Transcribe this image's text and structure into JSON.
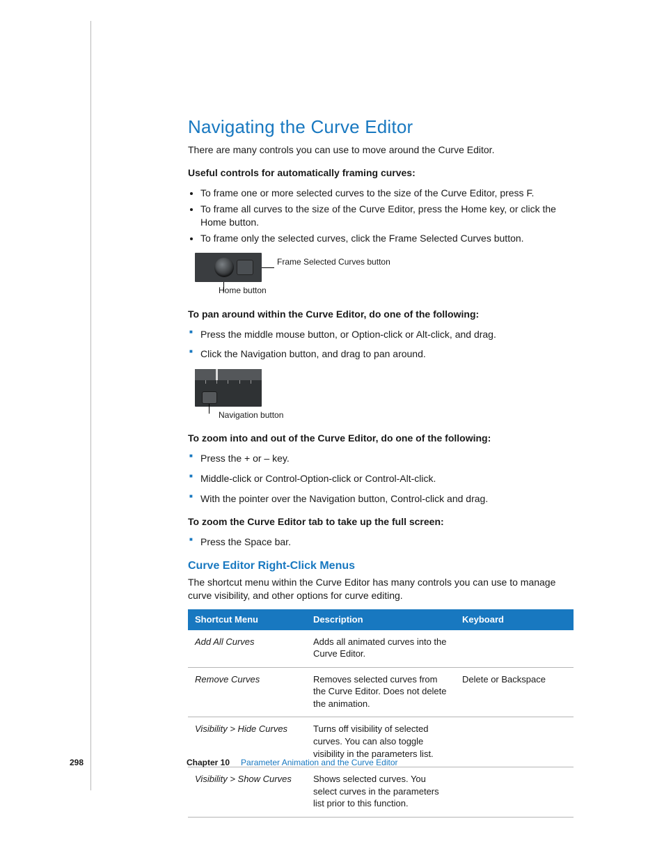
{
  "title": "Navigating the Curve Editor",
  "intro": "There are many controls you can use to move around the Curve Editor.",
  "useful_lead": "Useful controls for automatically framing curves:",
  "useful_items": [
    "To frame one or more selected curves to the size of the Curve Editor, press F.",
    "To frame all curves to the size of the Curve Editor, press the Home key, or click the Home button.",
    "To frame only the selected curves, click the Frame Selected Curves button."
  ],
  "fig1": {
    "caption_right": "Frame Selected Curves button",
    "caption_below": "Home button"
  },
  "pan_lead": "To pan around within the Curve Editor, do one of the following:",
  "pan_items": [
    "Press the middle mouse button, or Option-click or Alt-click, and drag.",
    "Click the Navigation button, and drag to pan around."
  ],
  "fig2": {
    "caption_below": "Navigation button"
  },
  "zoom_lead": "To zoom into and out of the Curve Editor, do one of the following:",
  "zoom_items": [
    "Press the + or – key.",
    "Middle-click or Control-Option-click or Control-Alt-click.",
    "With the pointer over the Navigation button, Control-click and drag."
  ],
  "full_lead": "To zoom the Curve Editor tab to take up the full screen:",
  "full_items": [
    "Press the Space bar."
  ],
  "subhead": "Curve Editor Right-Click Menus",
  "subhead_para": "The shortcut menu within the Curve Editor has many controls you can use to manage curve visibility, and other options for curve editing.",
  "table": {
    "headers": [
      "Shortcut Menu",
      "Description",
      "Keyboard"
    ],
    "rows": [
      [
        "Add All Curves",
        "Adds all animated curves into the Curve Editor.",
        ""
      ],
      [
        "Remove Curves",
        "Removes selected curves from the Curve Editor. Does not delete the animation.",
        "Delete or Backspace"
      ],
      [
        "Visibility > Hide Curves",
        "Turns off visibility of selected curves. You can also toggle visibility in the parameters list.",
        ""
      ],
      [
        "Visibility > Show Curves",
        "Shows selected curves. You select curves in the parameters list prior to this function.",
        ""
      ]
    ]
  },
  "footer": {
    "page": "298",
    "chapter": "Chapter 10",
    "chapter_title": "Parameter Animation and the Curve Editor"
  }
}
